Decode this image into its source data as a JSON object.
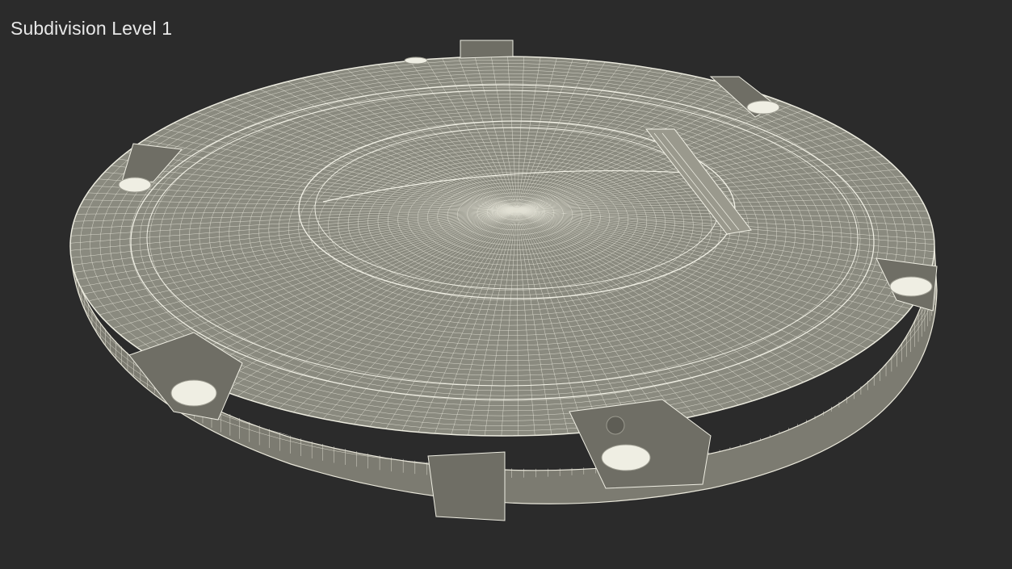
{
  "viewport": {
    "label": "Subdivision Level 1",
    "background": "#2b2b2b"
  },
  "model": {
    "description_icon": "wireframe-manhole-cover-icon",
    "surface_color": "#86857a",
    "wire_color": "#e9e7da",
    "side_color": "#7b7a70"
  }
}
